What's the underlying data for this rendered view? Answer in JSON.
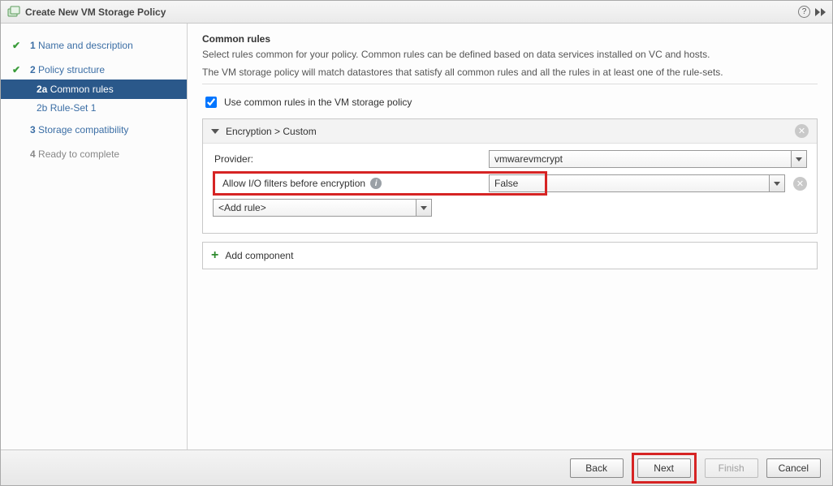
{
  "dialog": {
    "title": "Create New VM Storage Policy"
  },
  "nav": {
    "step1": {
      "num": "1",
      "label": "Name and description"
    },
    "step2": {
      "num": "2",
      "label": "Policy structure"
    },
    "step2a": {
      "num": "2a",
      "label": "Common rules"
    },
    "step2b": {
      "num": "2b",
      "label": "Rule-Set 1"
    },
    "step3": {
      "num": "3",
      "label": "Storage compatibility"
    },
    "step4": {
      "num": "4",
      "label": "Ready to complete"
    }
  },
  "content": {
    "heading": "Common rules",
    "desc1": "Select rules common for your policy. Common rules can be defined based on data services installed on VC and hosts.",
    "desc2": "The VM storage policy will match datastores that satisfy all common rules and all the rules in at least one of the rule-sets.",
    "use_common": "Use common rules in the VM storage policy",
    "component": {
      "title": "Encryption > Custom",
      "provider_label": "Provider:",
      "provider_value": "vmwarevmcrypt",
      "rule1_label": "Allow I/O filters before encryption",
      "rule1_value": "False",
      "add_rule": "<Add rule>"
    },
    "add_component": "Add component"
  },
  "footer": {
    "back": "Back",
    "next": "Next",
    "finish": "Finish",
    "cancel": "Cancel"
  }
}
